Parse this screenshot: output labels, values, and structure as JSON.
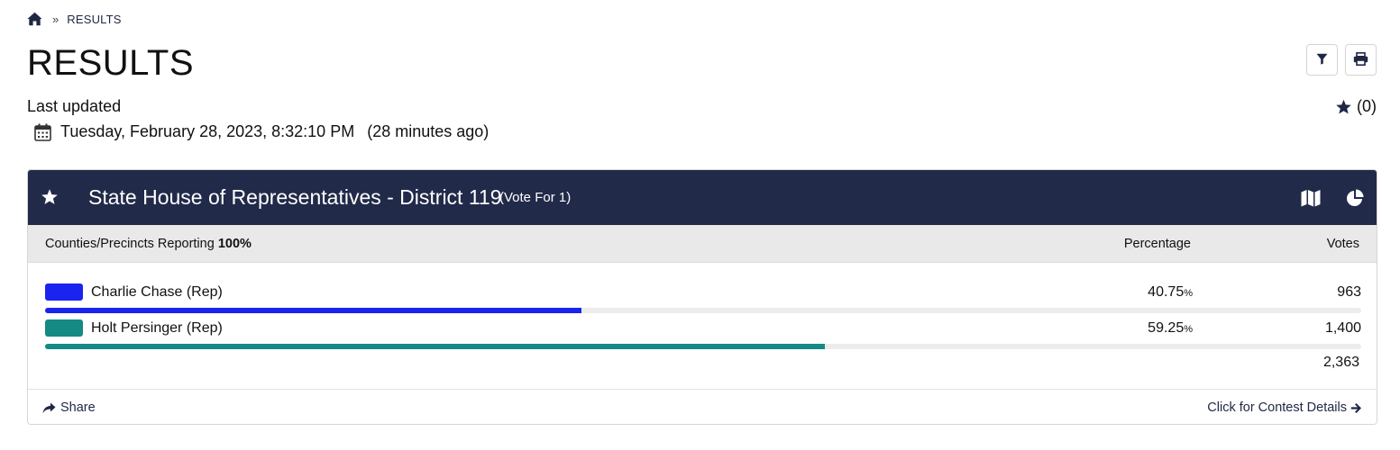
{
  "breadcrumb": {
    "home_icon": "home-icon",
    "separator": "»",
    "current": "RESULTS"
  },
  "page": {
    "title": "RESULTS",
    "last_updated_label": "Last updated",
    "last_updated_date": "Tuesday, February 28, 2023, 8:32:10 PM",
    "last_updated_ago": "(28 minutes ago)",
    "favorites_count": "(0)"
  },
  "toolbar": {
    "filter_icon": "filter-icon",
    "print_icon": "print-icon"
  },
  "contest": {
    "title": "State House of Representatives - District 119",
    "vote_for": "(Vote For 1)",
    "reporting_label": "Counties/Precincts Reporting",
    "reporting_value": "100%",
    "col_percentage": "Percentage",
    "col_votes": "Votes",
    "candidates": [
      {
        "name": "Charlie Chase (Rep)",
        "pct": "40.75",
        "pct_unit": "%",
        "share": 0.4075,
        "votes": "963",
        "color": "#1a24f0"
      },
      {
        "name": "Holt Persinger (Rep)",
        "pct": "59.25",
        "pct_unit": "%",
        "share": 0.5925,
        "votes": "1,400",
        "color": "#158a85"
      }
    ],
    "total_votes": "2,363",
    "header_color": "#212a49"
  },
  "footer": {
    "share_label": "Share",
    "details_label": "Click for Contest Details"
  }
}
